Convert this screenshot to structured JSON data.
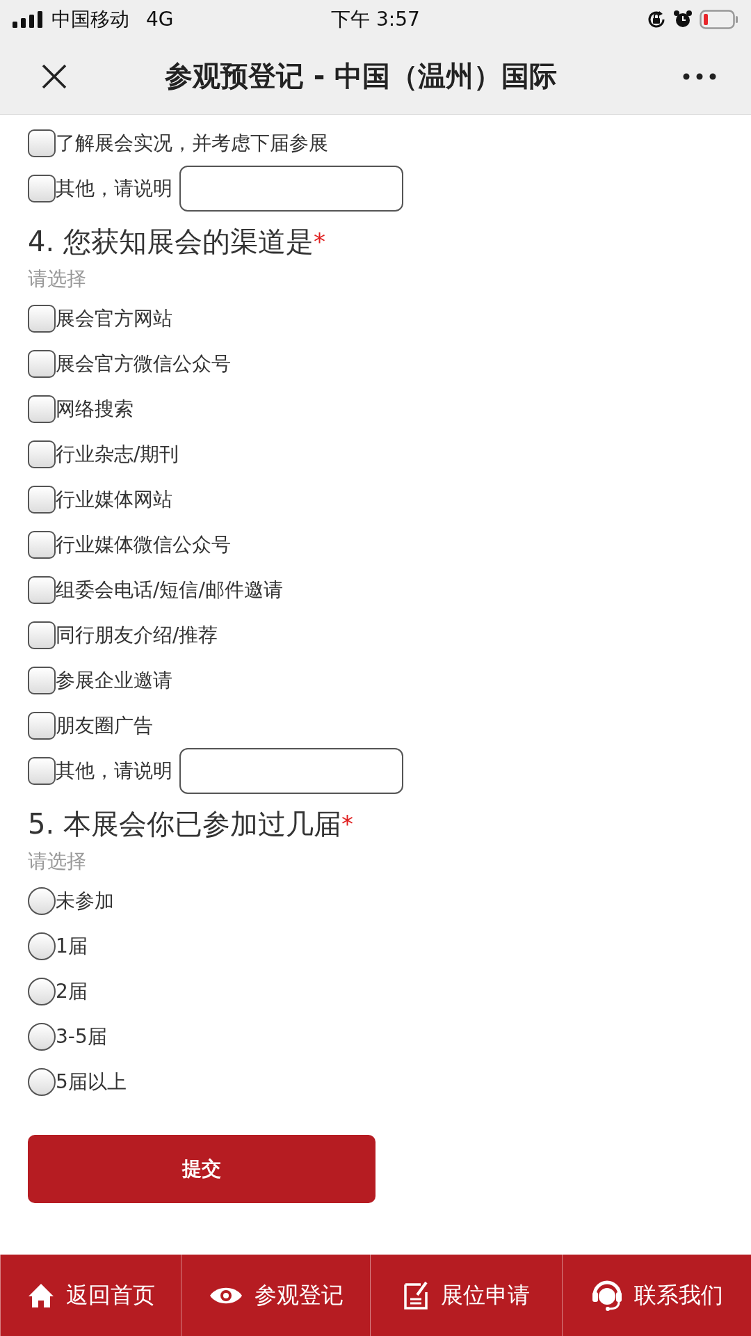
{
  "status_bar": {
    "carrier": "中国移动",
    "network": "4G",
    "time": "下午 3:57"
  },
  "title_bar": {
    "title": "参观预登记 - 中国（温州）国际"
  },
  "questions": [
    {
      "kind": "checkbox",
      "options": [
        {
          "label": "了解展会实况，并考虑下届参展",
          "checked": false,
          "kind": "plain"
        },
        {
          "label": "其他，请说明",
          "checked": false,
          "kind": "with_input"
        }
      ]
    },
    {
      "kind": "checkbox",
      "title": "4. 您获知展会的渠道是",
      "required_mark": "*",
      "hint": "请选择",
      "options": [
        {
          "label": "展会官方网站",
          "checked": false,
          "kind": "plain"
        },
        {
          "label": "展会官方微信公众号",
          "checked": false,
          "kind": "plain"
        },
        {
          "label": "网络搜索",
          "checked": false,
          "kind": "plain"
        },
        {
          "label": "行业杂志/期刊",
          "checked": false,
          "kind": "plain"
        },
        {
          "label": "行业媒体网站",
          "checked": false,
          "kind": "plain"
        },
        {
          "label": "行业媒体微信公众号",
          "checked": false,
          "kind": "plain"
        },
        {
          "label": "组委会电话/短信/邮件邀请",
          "checked": false,
          "kind": "plain"
        },
        {
          "label": "同行朋友介绍/推荐",
          "checked": false,
          "kind": "plain"
        },
        {
          "label": "参展企业邀请",
          "checked": false,
          "kind": "plain"
        },
        {
          "label": "朋友圈广告",
          "checked": false,
          "kind": "plain"
        },
        {
          "label": "其他，请说明",
          "checked": false,
          "kind": "with_input"
        }
      ]
    },
    {
      "kind": "radio",
      "title": "5. 本展会你已参加过几届",
      "required_mark": "*",
      "hint": "请选择",
      "options": [
        {
          "label": "未参加",
          "selected": false,
          "kind": "plain"
        },
        {
          "label": "1届",
          "selected": false,
          "kind": "plain"
        },
        {
          "label": "2届",
          "selected": false,
          "kind": "plain"
        },
        {
          "label": "3-5届",
          "selected": false,
          "kind": "plain"
        },
        {
          "label": "5届以上",
          "selected": false,
          "kind": "plain"
        }
      ]
    }
  ],
  "submit_button": "提交",
  "bottom_nav": [
    {
      "label": "返回首页",
      "kind": "home"
    },
    {
      "label": "参观登记",
      "kind": "eye"
    },
    {
      "label": "展位申请",
      "kind": "form"
    },
    {
      "label": "联系我们",
      "kind": "headset"
    }
  ]
}
